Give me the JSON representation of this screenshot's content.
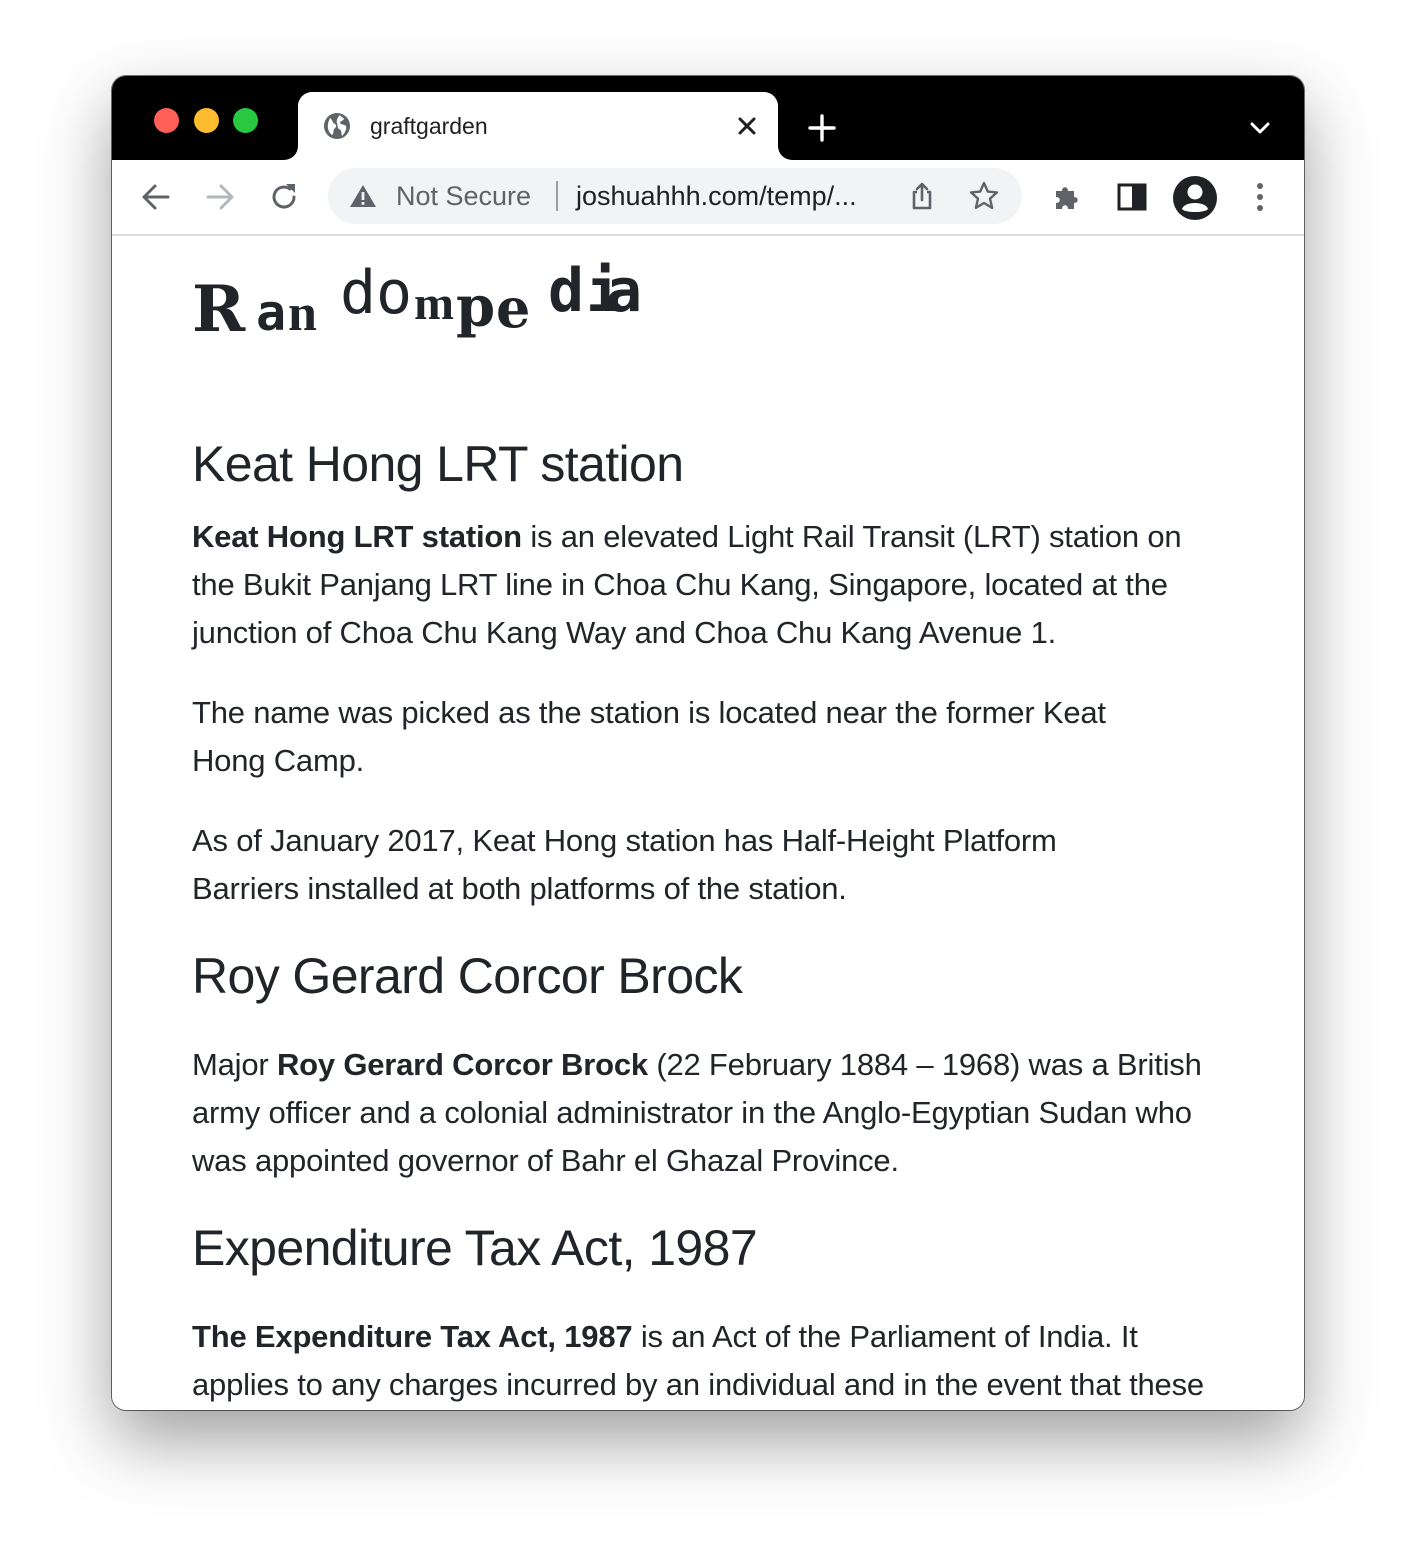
{
  "browser": {
    "tab": {
      "title": "graftgarden",
      "favicon": "globe-icon"
    },
    "omnibox": {
      "security_label": "Not Secure",
      "url": "joshuahhh.com/temp/..."
    },
    "icons": {
      "back": "back-arrow-icon",
      "forward": "forward-arrow-icon",
      "reload": "reload-icon",
      "share": "share-icon",
      "bookmark": "star-icon",
      "extensions": "puzzle-icon",
      "side_panel": "side-panel-icon",
      "profile": "avatar-icon",
      "menu": "kebab-menu-icon",
      "new_tab": "plus-icon",
      "tab_search": "chevron-down-icon",
      "close_tab": "close-icon"
    },
    "colors": {
      "tabstrip": "#000000",
      "traffic_red": "#fe5f57",
      "traffic_yellow": "#febc2e",
      "traffic_green": "#28c840"
    }
  },
  "page": {
    "logo_letters": [
      "R",
      "a",
      "n",
      "d",
      "o",
      "m",
      "p",
      "e",
      "d",
      "i",
      "a"
    ],
    "sections": [
      {
        "heading": "Keat Hong LRT station",
        "paragraphs": [
          {
            "bold": "Keat Hong LRT station",
            "text": " is an elevated Light Rail Transit (LRT) station on the Bukit Panjang LRT line in Choa Chu Kang, Singapore, located at the junction of Choa Chu Kang Way and Choa Chu Kang Avenue 1."
          },
          {
            "text": "The name was picked as the station is located near the former Keat Hong Camp."
          },
          {
            "text": "As of January 2017, Keat Hong station has Half-Height Platform Barriers installed at both platforms of the station."
          }
        ]
      },
      {
        "heading": "Roy Gerard Corcor Brock",
        "paragraphs": [
          {
            "prefix": "Major ",
            "bold": "Roy Gerard Corcor Brock",
            "text": " (22 February 1884 – 1968) was a British army officer and a colonial administrator in the Anglo-Egyptian Sudan who was appointed governor of Bahr el Ghazal Province."
          }
        ]
      },
      {
        "heading": "Expenditure Tax Act, 1987",
        "paragraphs": [
          {
            "bold": "The Expenditure Tax Act, 1987",
            "text": " is an Act of the Parliament of India. It applies to any charges incurred by an individual and in the event that these charges are implied to be chargeable expenditure. The Act is applicable to all the States and Union Territories in India."
          }
        ]
      }
    ]
  }
}
